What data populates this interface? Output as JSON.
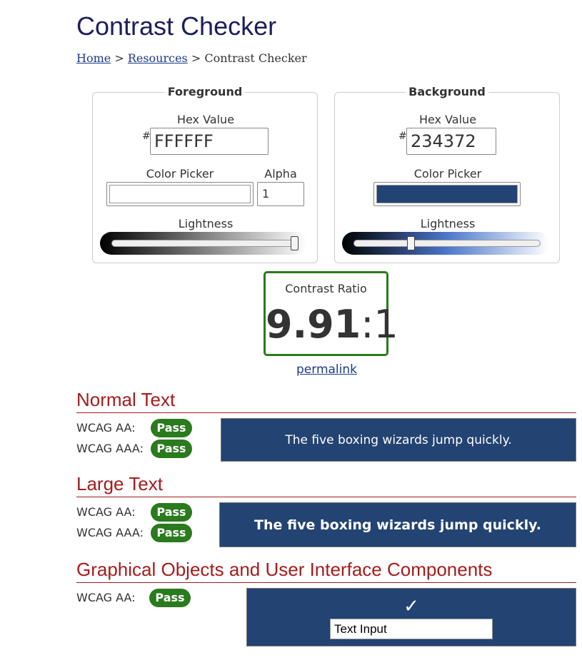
{
  "page": {
    "title": "Contrast Checker"
  },
  "breadcrumb": {
    "home": "Home",
    "sep1": " > ",
    "resources": "Resources",
    "sep2": " > ",
    "current": "Contrast Checker"
  },
  "foreground": {
    "legend": "Foreground",
    "hex_label": "Hex Value",
    "hash": "#",
    "hex_value": "FFFFFF",
    "color_picker_label": "Color Picker",
    "color": "#FFFFFF",
    "alpha_label": "Alpha",
    "alpha_value": "1",
    "lightness_label": "Lightness",
    "lightness_level": 1.0,
    "gradient_start": "#000000",
    "gradient_end": "#FFFFFF"
  },
  "background": {
    "legend": "Background",
    "hex_label": "Hex Value",
    "hash": "#",
    "hex_value": "234372",
    "color_picker_label": "Color Picker",
    "color": "#234372",
    "lightness_label": "Lightness",
    "lightness_level": 0.3,
    "gradient_start": "#000000",
    "gradient_mid": "#4a75c9",
    "gradient_end": "#FFFFFF"
  },
  "contrast": {
    "label": "Contrast Ratio",
    "ratio_bold": "9.91",
    "ratio_suffix": ":1",
    "border_color": "#2A7A1E"
  },
  "permalink": "permalink",
  "normal_text": {
    "heading": "Normal Text",
    "aa_label": "WCAG AA:",
    "aa_result": "Pass",
    "aaa_label": "WCAG AAA:",
    "aaa_result": "Pass",
    "sample": "The five boxing wizards jump quickly."
  },
  "large_text": {
    "heading": "Large Text",
    "aa_label": "WCAG AA:",
    "aa_result": "Pass",
    "aaa_label": "WCAG AAA:",
    "aaa_result": "Pass",
    "sample": "The five boxing wizards jump quickly."
  },
  "graphical": {
    "heading": "Graphical Objects and User Interface Components",
    "aa_label": "WCAG AA:",
    "aa_result": "Pass",
    "checkmark_icon": "checkmark-icon",
    "text_input_value": "Text Input"
  },
  "colors": {
    "title": "#1C1F5C",
    "section_heading": "#A51C1C",
    "pass_badge": "#2A7A1E",
    "link": "#1C3A8C"
  }
}
